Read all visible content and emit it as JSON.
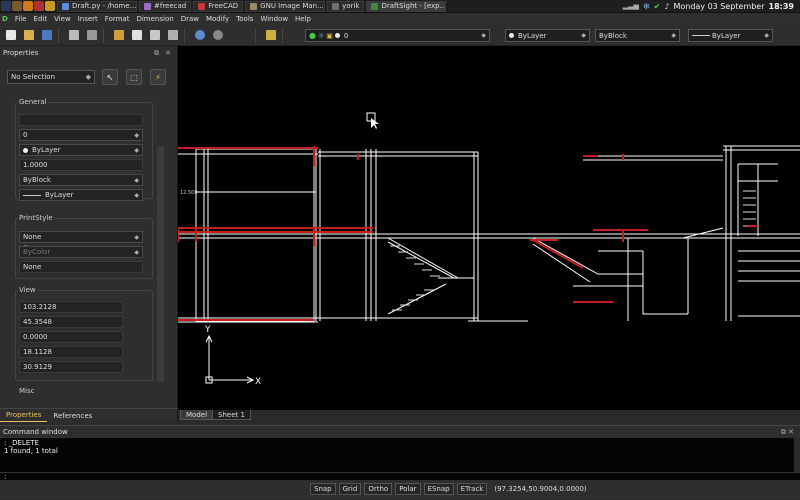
{
  "taskbar": {
    "tasks": [
      {
        "label": "Draft.py - /home...",
        "color": "#5a8fd8"
      },
      {
        "label": "#freecad",
        "color": "#9a6ad0"
      },
      {
        "label": "FreeCAD",
        "color": "#c83a3a"
      },
      {
        "label": "GNU Image Man...",
        "color": "#a08a60"
      },
      {
        "label": "yorik",
        "color": "#707070"
      },
      {
        "label": "DraftSight - [exp...",
        "color": "#3a8a3a"
      }
    ],
    "clock_date": "Monday 03 September",
    "clock_time": "18:39"
  },
  "menu": [
    "File",
    "Edit",
    "View",
    "Insert",
    "Format",
    "Dimension",
    "Draw",
    "Modify",
    "Tools",
    "Window",
    "Help"
  ],
  "toolbar": {
    "layer_value": "0",
    "color_value": "ByLayer",
    "linestyle_value": "ByBlock",
    "lineweight_value": "ByLayer"
  },
  "properties": {
    "title": "Properties",
    "selection": "No Selection",
    "general_label": "General",
    "general_fields": {
      "layer": "0",
      "color": "ByLayer",
      "scale": "1.0000",
      "linestyle": "ByBlock",
      "lineweight": "ByLayer"
    },
    "printstyle_label": "PrintStyle",
    "printstyle_fields": {
      "style": "None",
      "color": "ByColor",
      "table": "None"
    },
    "view_label": "View",
    "view_fields": [
      "103.2128",
      "45.3548",
      "0.0000",
      "18.1128",
      "30.9129"
    ],
    "misc_label": "Misc",
    "tabs": [
      "Properties",
      "References"
    ]
  },
  "layout_tabs": [
    "Model",
    "Sheet 1"
  ],
  "axes": {
    "x": "X",
    "y": "Y"
  },
  "drawing_dimension": "12.500",
  "command": {
    "title": "Command window",
    "lines": [
      ": _DELETE",
      "1 found, 1 total",
      ":"
    ]
  },
  "status": {
    "buttons": [
      "Snap",
      "Grid",
      "Ortho",
      "Polar",
      "ESnap",
      "ETrack"
    ],
    "coords": "(97.3254,50.9004,0.0000)"
  }
}
